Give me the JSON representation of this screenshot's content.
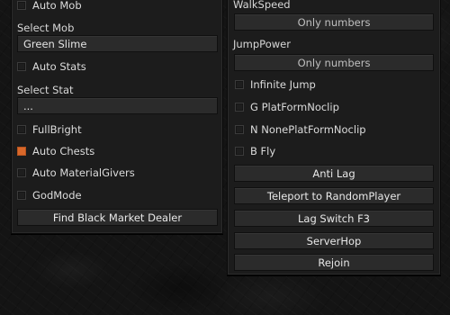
{
  "left_panel": {
    "auto_mob": {
      "label": "Auto Mob",
      "checked": false
    },
    "select_mob": {
      "label": "Select Mob",
      "value": "Green Slime"
    },
    "auto_stats": {
      "label": "Auto Stats",
      "checked": false
    },
    "select_stat": {
      "label": "Select Stat",
      "value": "..."
    },
    "fullbright": {
      "label": "FullBright",
      "checked": false
    },
    "auto_chests": {
      "label": "Auto Chests",
      "checked": true
    },
    "auto_material_givers": {
      "label": "Auto MaterialGivers",
      "checked": false
    },
    "godmode": {
      "label": "GodMode",
      "checked": false
    },
    "find_black_market_button": "Find Black Market Dealer"
  },
  "right_panel": {
    "walkspeed": {
      "label": "WalkSpeed",
      "placeholder": "Only numbers"
    },
    "jumppower": {
      "label": "JumpPower",
      "placeholder": "Only numbers"
    },
    "infinite_jump": {
      "label": "Infinite Jump",
      "checked": false
    },
    "g_platform_noclip": {
      "label": "G PlatFormNoclip",
      "checked": false
    },
    "n_noneplatform_noclip": {
      "label": "N NonePlatFormNoclip",
      "checked": false
    },
    "b_fly": {
      "label": "B Fly",
      "checked": false
    },
    "buttons": [
      "Anti Lag",
      "Teleport to RandomPlayer",
      "Lag Switch F3",
      "ServerHop",
      "Rejoin"
    ]
  },
  "colors": {
    "accent": "#d9682a",
    "panel": "#1c1c1c",
    "field": "#2b2b2b"
  }
}
